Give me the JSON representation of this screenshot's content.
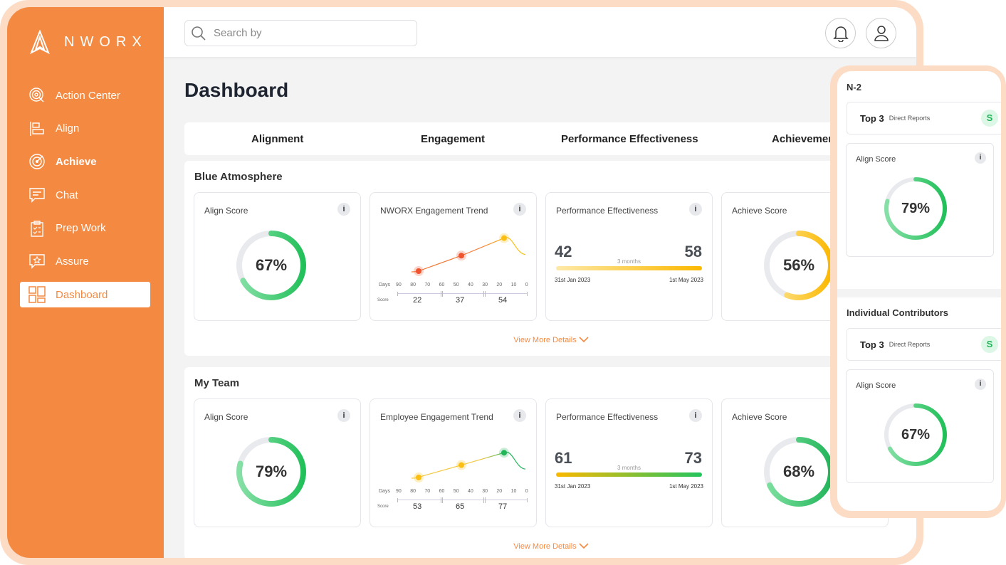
{
  "brand": {
    "name": "NWORX",
    "accent": "#f48a42"
  },
  "sidebar": {
    "items": [
      {
        "label": "Action Center",
        "icon": "target-cursor-icon",
        "active": false
      },
      {
        "label": "Align",
        "icon": "align-icon",
        "active": false
      },
      {
        "label": "Achieve",
        "icon": "bullseye-icon",
        "active": false
      },
      {
        "label": "Chat",
        "icon": "chat-icon",
        "active": false
      },
      {
        "label": "Prep Work",
        "icon": "clipboard-icon",
        "active": false
      },
      {
        "label": "Assure",
        "icon": "star-message-icon",
        "active": false
      },
      {
        "label": "Dashboard",
        "icon": "dashboard-icon",
        "active": true
      }
    ]
  },
  "header": {
    "search_placeholder": "Search by",
    "icons": [
      "bell-icon",
      "user-icon"
    ]
  },
  "page_title": "Dashboard",
  "tabs": [
    "Alignment",
    "Engagement",
    "Performance Effectiveness",
    "Achievement"
  ],
  "sections": [
    {
      "title": "Blue Atmosphere",
      "view_more": "View More Details",
      "align": {
        "title": "Align Score",
        "value": 67,
        "label": "67%"
      },
      "trend": {
        "title": "NWORX Engagement Trend",
        "days_label": "Days",
        "score_label": "Score",
        "days": [
          "90",
          "80",
          "70",
          "60",
          "50",
          "40",
          "30",
          "20",
          "10",
          "0"
        ],
        "scores": [
          "22",
          "37",
          "54"
        ],
        "points": [
          {
            "day": 75,
            "score": 22,
            "color": "#f0542e"
          },
          {
            "day": 45,
            "score": 37,
            "color": "#f0542e"
          },
          {
            "day": 15,
            "score": 54,
            "color": "#fbbf13"
          }
        ],
        "line_colors": [
          "#f47a3a",
          "#fbbf13"
        ]
      },
      "perf": {
        "title": "Performance Effectiveness",
        "start": "42",
        "end": "58",
        "period": "3 months",
        "start_date": "31st Jan 2023",
        "end_date": "1st May 2023",
        "bar_colors": [
          "#fde9a8",
          "#fbb800"
        ]
      },
      "achieve": {
        "title": "Achieve Score",
        "value": 56,
        "label": "56%",
        "colors": [
          "#fde79a",
          "#fbb800"
        ]
      }
    },
    {
      "title": "My Team",
      "view_more": "View More Details",
      "align": {
        "title": "Align Score",
        "value": 79,
        "label": "79%"
      },
      "trend": {
        "title": "Employee Engagement Trend",
        "days_label": "Days",
        "score_label": "Score",
        "days": [
          "90",
          "80",
          "70",
          "60",
          "50",
          "40",
          "30",
          "20",
          "10",
          "0"
        ],
        "scores": [
          "53",
          "65",
          "77"
        ],
        "points": [
          {
            "day": 75,
            "score": 53,
            "color": "#fbbf13"
          },
          {
            "day": 45,
            "score": 65,
            "color": "#fbbf13"
          },
          {
            "day": 15,
            "score": 77,
            "color": "#22b55a"
          }
        ],
        "line_colors": [
          "#f5c842",
          "#22b55a"
        ]
      },
      "perf": {
        "title": "Performance Effectiveness",
        "start": "61",
        "end": "73",
        "period": "3 months",
        "start_date": "31st Jan 2023",
        "end_date": "1st May 2023",
        "bar_colors": [
          "#fbb800",
          "#22c55e"
        ]
      },
      "achieve": {
        "title": "Achieve Score",
        "value": 68,
        "label": "68%",
        "colors": [
          "#7ee0a0",
          "#22b55a"
        ]
      }
    }
  ],
  "panel": {
    "blocks": [
      {
        "title": "N-2",
        "top": "Top 3",
        "top_sub": "Direct Reports",
        "avatar": "S",
        "card_title": "Align Score",
        "value": 79,
        "label": "79%"
      },
      {
        "title": "Individual Contributors",
        "top": "Top 3",
        "top_sub": "Direct Reports",
        "avatar": "S",
        "card_title": "Align Score",
        "value": 67,
        "label": "67%"
      }
    ]
  }
}
